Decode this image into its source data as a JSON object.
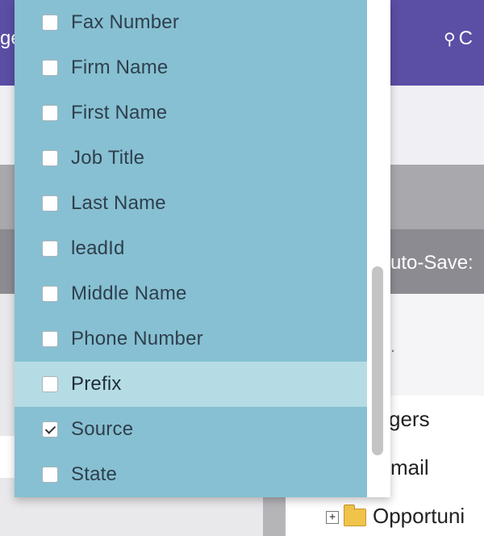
{
  "background": {
    "header_left_text": "ge",
    "header_right_text": "C",
    "header_right_icon": "people-icon",
    "autosave_text": "uto-Save:",
    "tree": {
      "items": [
        {
          "label": "gers"
        },
        {
          "label": "mail"
        },
        {
          "label": "Opportuni",
          "expander": "+",
          "icon": "folder-icon"
        }
      ]
    }
  },
  "dropdown": {
    "items": [
      {
        "label": "Fax Number",
        "checked": false
      },
      {
        "label": "Firm Name",
        "checked": false
      },
      {
        "label": "First Name",
        "checked": false
      },
      {
        "label": "Job Title",
        "checked": false
      },
      {
        "label": "Last Name",
        "checked": false
      },
      {
        "label": "leadId",
        "checked": false
      },
      {
        "label": "Middle Name",
        "checked": false
      },
      {
        "label": "Phone Number",
        "checked": false
      },
      {
        "label": "Prefix",
        "checked": false,
        "highlighted": true
      },
      {
        "label": "Source",
        "checked": true
      },
      {
        "label": "State",
        "checked": false
      }
    ]
  },
  "colors": {
    "header_purple": "#5a4ea5",
    "list_blue": "#87c0d2",
    "highlight_blue": "#b5dce4",
    "orange_accent": "#f08a2c"
  }
}
